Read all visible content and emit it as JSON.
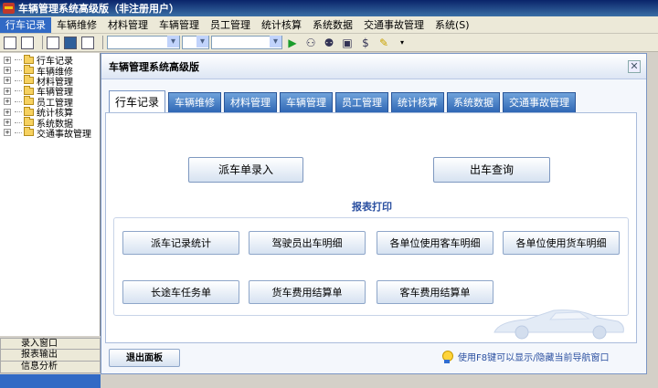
{
  "window": {
    "title": "车辆管理系统高级版（非注册用户）"
  },
  "menu": [
    {
      "label": "行车记录",
      "active": true
    },
    {
      "label": "车辆维修",
      "active": false
    },
    {
      "label": "材料管理",
      "active": false
    },
    {
      "label": "车辆管理",
      "active": false
    },
    {
      "label": "员工管理",
      "active": false
    },
    {
      "label": "统计核算",
      "active": false
    },
    {
      "label": "系统数据",
      "active": false
    },
    {
      "label": "交通事故管理",
      "active": false
    },
    {
      "label": "系统(S)",
      "active": false
    }
  ],
  "tree": [
    {
      "label": "行车记录",
      "open": true
    },
    {
      "label": "车辆维修",
      "open": false
    },
    {
      "label": "材料管理",
      "open": false
    },
    {
      "label": "车辆管理",
      "open": false
    },
    {
      "label": "员工管理",
      "open": false
    },
    {
      "label": "统计核算",
      "open": false
    },
    {
      "label": "系统数据",
      "open": false
    },
    {
      "label": "交通事故管理",
      "open": false
    }
  ],
  "side_tabs": [
    "录入窗口",
    "报表输出",
    "信息分析"
  ],
  "panel": {
    "title": "车辆管理系统高级版",
    "tabs": [
      "行车记录",
      "车辆维修",
      "材料管理",
      "车辆管理",
      "员工管理",
      "统计核算",
      "系统数据",
      "交通事故管理"
    ],
    "main_buttons": {
      "dispatch_entry": "派车单录入",
      "dispatch_query": "出车查询"
    },
    "report_title": "报表打印",
    "report_buttons": [
      "派车记录统计",
      "驾驶员出车明细",
      "各单位使用客车明细",
      "各单位使用货车明细",
      "长途车任务单",
      "货车费用结算单",
      "客车费用结算单"
    ],
    "exit_label": "退出面板",
    "hint": "使用F8键可以显示/隐藏当前导航窗口"
  },
  "colors": {
    "accent": "#316ac5",
    "title_bar": "#0a246a",
    "tab_blue": "#2f67b5"
  }
}
